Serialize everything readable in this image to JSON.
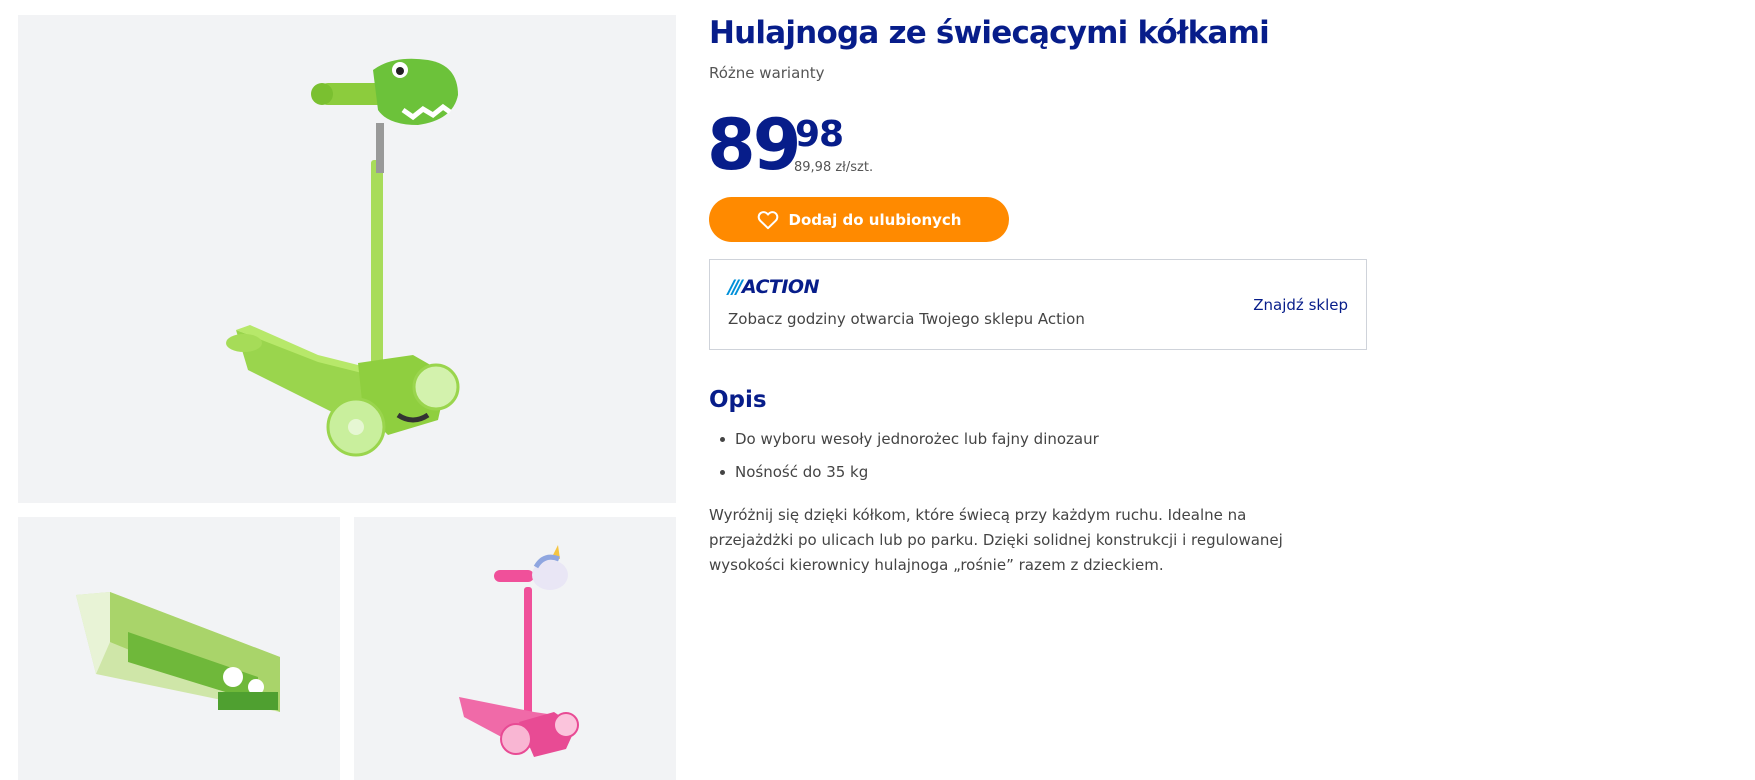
{
  "product": {
    "title": "Hulajnoga ze świecącymi kółkami",
    "subtitle": "Różne warianty",
    "price_integer": "89",
    "price_decimal": "98",
    "unit_price": "89,98 zł/szt."
  },
  "favorite_button": {
    "label": "Dodaj do ulubionych",
    "icon": "heart-icon"
  },
  "store": {
    "logo_slashes": "///",
    "logo_text": "ACTION",
    "hours_text": "Zobacz godziny otwarcia Twojego sklepu Action",
    "find_link": "Znajdź sklep"
  },
  "description": {
    "heading": "Opis",
    "bullets": [
      "Do wyboru wesoły jednorożec lub fajny dinozaur",
      "Nośność do 35 kg"
    ],
    "text": "Wyróżnij się dzięki kółkom, które świecą przy każdym ruchu. Idealne na przejażdżki po ulicach lub po parku. Dzięki solidnej konstrukcji i regulowanej wysokości kierownicy hulajnoga „rośnie” razem z dzieckiem."
  },
  "gallery": {
    "main_image": "green-dinosaur-scooter",
    "thumbnails": [
      "scooter-box",
      "pink-unicorn-scooter"
    ]
  },
  "colors": {
    "brand_blue": "#071d8a",
    "accent_orange": "#ff8a00",
    "scooter_green": "#8fd14a",
    "scooter_pink": "#f0509a"
  }
}
